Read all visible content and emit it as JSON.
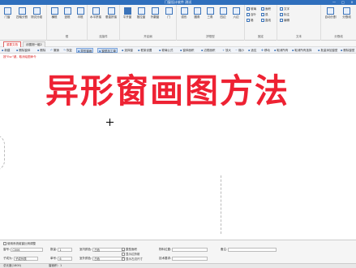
{
  "window": {
    "title": "门窗设计软件 测试",
    "controls": [
      "—",
      "□",
      "×"
    ]
  },
  "ribbon": {
    "groups": [
      {
        "name": "",
        "buttons": [
          "门窗",
          "四轴分割",
          "测试分组"
        ]
      },
      {
        "name": "框",
        "buttons": [
          "横框",
          "竖框",
          "半框"
        ]
      },
      {
        "name": "连接件",
        "buttons": [
          "水平拼接",
          "垂直拼接"
        ]
      },
      {
        "name": "开启扇",
        "buttons": [
          "平开窗",
          "推拉窗",
          "外翻窗",
          "门"
        ]
      },
      {
        "name": "拼框型",
        "buttons": [
          "弧形",
          "圆角",
          "三角",
          "四边",
          "六边"
        ]
      },
      {
        "name": "固定",
        "buttons": []
      },
      {
        "name": "工具",
        "small": [
          "玻璃",
          "百叶",
          "格",
          "面积",
          "弧",
          "T",
          "直线"
        ]
      },
      {
        "name": "文本",
        "small": [
          "文字",
          "标注",
          "编辑"
        ]
      },
      {
        "name": "分割线",
        "buttons": [
          "自动分割",
          "分割线"
        ]
      }
    ]
  },
  "doc_tabs": [
    {
      "label": "重要文档",
      "active": true
    },
    {
      "label": "示图测一组2",
      "active": false
    }
  ],
  "toolbar": [
    {
      "label": "新建",
      "selected": false
    },
    {
      "label": "删除窗体",
      "selected": false
    },
    {
      "label": "删除",
      "selected": false
    },
    {
      "label": "撤销",
      "selected": false
    },
    {
      "label": "恢复",
      "selected": false
    },
    {
      "label": "异形窗画",
      "selected": true
    },
    {
      "label": "窗型加工单",
      "selected": true
    },
    {
      "label": "选择窗",
      "selected": false
    },
    {
      "label": "框架设置",
      "selected": false
    },
    {
      "label": "玻璃公式",
      "selected": false
    },
    {
      "label": "窗体面积",
      "selected": false
    },
    {
      "label": "边框面积",
      "selected": false
    },
    {
      "label": "放大",
      "selected": false
    },
    {
      "label": "缩小",
      "selected": false
    },
    {
      "label": "适应",
      "selected": false
    },
    {
      "label": "移动",
      "selected": false
    },
    {
      "label": "取消所有",
      "selected": false
    },
    {
      "label": "取消所有选择",
      "selected": false
    },
    {
      "label": "批量添加窗型",
      "selected": false
    },
    {
      "label": "删除窗型",
      "selected": false
    }
  ],
  "canvas": {
    "hint": "按\"Esc\"键，取消绘图命令",
    "big_title": "异形窗画图方法"
  },
  "bottom": {
    "checkboxes": [
      "使用系统组窗比例调整"
    ],
    "row1": {
      "code_label": "窗号:",
      "code_value": "C006",
      "qty_label": "数量:",
      "qty_value": "1",
      "inner_color_label": "室内颜色:",
      "inner_color_value": "白色",
      "glass_check": "整型面积",
      "profile_label": "物料位置:",
      "profile_value": "",
      "remark_label": "备注:",
      "remark_value": ""
    },
    "row1b": {
      "check": "显示边折射"
    },
    "row2": {
      "type_label": "子成为:",
      "type_value": "子成列表",
      "sides_label": "单号:",
      "sides_value": "6",
      "outer_color_label": "室外颜色:",
      "outer_color_value": "白色",
      "show_check": "显示左边尺寸",
      "tech_label": "技术要求:",
      "tech_value": ""
    },
    "status": {
      "left": "总长度(1800)",
      "right": "窗面积：1"
    }
  }
}
